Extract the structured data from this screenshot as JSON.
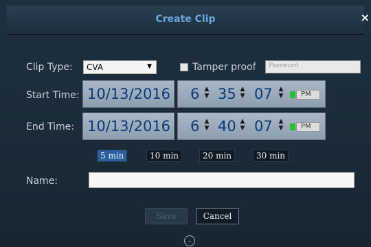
{
  "dialog": {
    "title": "Create Clip",
    "close_glyph": "×"
  },
  "clip_type": {
    "label": "Clip Type:",
    "value": "CVA",
    "arrow_glyph": "▼"
  },
  "tamper": {
    "label": "Tamper proof",
    "checked": false,
    "password_placeholder": "Password"
  },
  "start": {
    "label": "Start Time:",
    "date": "10/13/2016",
    "hour": "6",
    "minute": "35",
    "second": "07",
    "ampm": "PM"
  },
  "end": {
    "label": "End Time:",
    "date": "10/13/2016",
    "hour": "6",
    "minute": "40",
    "second": "07",
    "ampm": "PM"
  },
  "durations": [
    {
      "label": "5 min",
      "active": true
    },
    {
      "label": "10 min",
      "active": false
    },
    {
      "label": "20 min",
      "active": false
    },
    {
      "label": "30 min",
      "active": false
    }
  ],
  "name": {
    "label": "Name:",
    "value": ""
  },
  "buttons": {
    "save": "Save",
    "cancel": "Cancel"
  },
  "icons": {
    "spinner": "spin-arrows-icon",
    "expand": "chevron-down-icon",
    "expand_glyph": "⌄",
    "spin_up": "▲",
    "spin_down": "▼",
    "ampm_indicator_color": "#2bbf2b"
  },
  "colors": {
    "title": "#6aa6e0",
    "date_text": "#0d3a78",
    "active_duration": "#2d5ea0"
  }
}
